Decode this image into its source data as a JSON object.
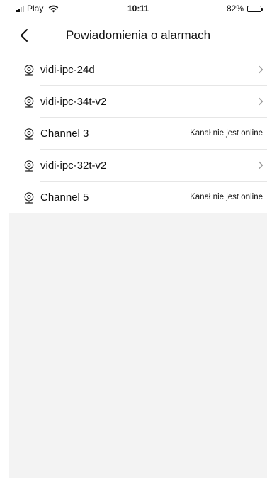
{
  "status_bar": {
    "carrier": "Play",
    "time": "10:11",
    "battery": "82%",
    "battery_level": 0.82
  },
  "nav": {
    "title": "Powiadomienia o alarmach",
    "back_icon": "chevron-left-icon"
  },
  "devices": [
    {
      "name": "vidi-ipc-24d",
      "icon": "camera-icon",
      "status": "",
      "has_chevron": true
    },
    {
      "name": "vidi-ipc-34t-v2",
      "icon": "camera-icon",
      "status": "",
      "has_chevron": true
    },
    {
      "name": "Channel 3",
      "icon": "camera-icon",
      "status": "Kanał nie jest online",
      "has_chevron": false
    },
    {
      "name": "vidi-ipc-32t-v2",
      "icon": "camera-icon",
      "status": "",
      "has_chevron": true
    },
    {
      "name": "Channel 5",
      "icon": "camera-icon",
      "status": "Kanał nie jest online",
      "has_chevron": false
    }
  ],
  "colors": {
    "background": "#f3f3f3",
    "separator": "#e6e6e6",
    "text": "#111111"
  }
}
